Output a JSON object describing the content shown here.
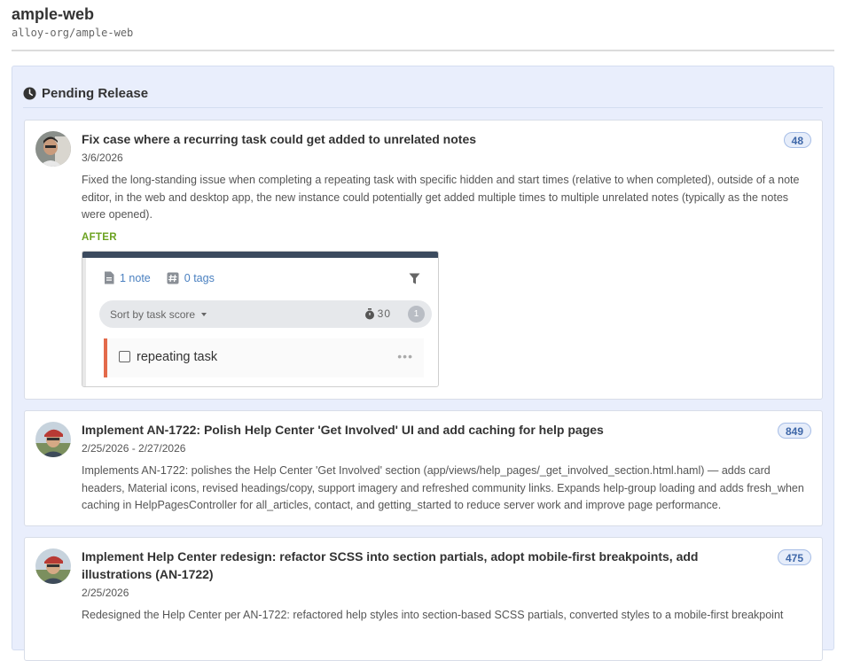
{
  "repo": {
    "name": "ample-web",
    "path": "alloy-org/ample-web"
  },
  "panel": {
    "title": "Pending Release",
    "icon": "clock-icon"
  },
  "cards": [
    {
      "title": "Fix case where a recurring task could get added to unrelated notes",
      "date": "3/6/2026",
      "badge": "48",
      "body": "Fixed the long-standing issue when completing a repeating task with specific hidden and start times (relative to when completed), outside of a note editor, in the web and desktop app, the new instance could potentially get added multiple times to multiple unrelated notes (typically as the notes were opened).",
      "after_label": "AFTER",
      "screenshot": {
        "notes_label": "1 note",
        "tags_label": "0 tags",
        "sort_label": "Sort by task score",
        "score": "30",
        "count": "1",
        "task_text": "repeating task",
        "more": "•••"
      }
    },
    {
      "title": "Implement AN-1722: Polish Help Center 'Get Involved' UI and add caching for help pages",
      "date": "2/25/2026 - 2/27/2026",
      "badge": "849",
      "body": "Implements AN-1722: polishes the Help Center 'Get Involved' section (app/views/help_pages/_get_involved_section.html.haml) — adds card headers, Material icons, revised headings/copy, support imagery and refreshed community links. Expands help-group loading and adds fresh_when caching in HelpPagesController for all_articles, contact, and getting_started to reduce server work and improve page performance."
    },
    {
      "title": "Implement Help Center redesign: refactor SCSS into section partials, adopt mobile-first breakpoints, add illustrations (AN-1722)",
      "date": "2/25/2026",
      "badge": "475",
      "body": "Redesigned the Help Center per AN-1722: refactored help styles into section-based SCSS partials, converted styles to a mobile-first breakpoint"
    }
  ],
  "colors": {
    "panel_bg": "#e9eefc",
    "badge_text": "#3e67a8",
    "after_green": "#6ba21f",
    "task_bar": "#e36a4b"
  }
}
